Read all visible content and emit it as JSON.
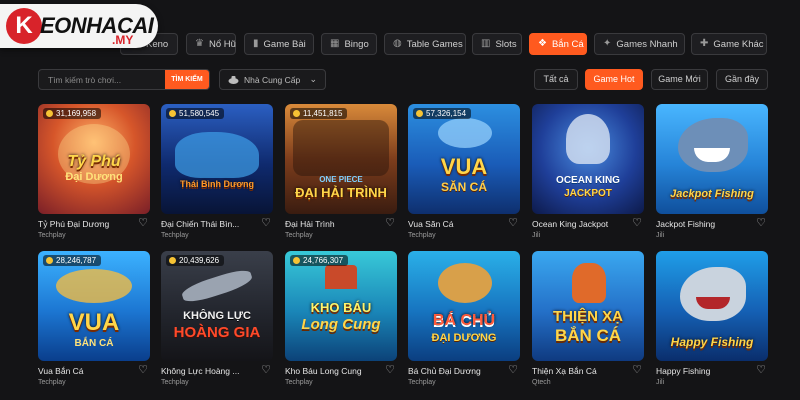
{
  "logo": {
    "letter": "K",
    "text": "EONHACAI",
    "suffix": ".MY"
  },
  "categories": [
    {
      "label": "Keno",
      "icon": "keno-icon",
      "glyph": "◉"
    },
    {
      "label": "Nổ Hũ",
      "icon": "jar-icon",
      "glyph": "♛"
    },
    {
      "label": "Game Bài",
      "icon": "cards-icon",
      "glyph": "▮"
    },
    {
      "label": "Bingo",
      "icon": "bingo-icon",
      "glyph": "▦"
    },
    {
      "label": "Table Games",
      "icon": "table-icon",
      "glyph": "◍"
    },
    {
      "label": "Slots",
      "icon": "slots-icon",
      "glyph": "▥"
    },
    {
      "label": "Bắn Cá",
      "icon": "fish-icon",
      "glyph": "❖",
      "active": true
    },
    {
      "label": "Games Nhanh",
      "icon": "quick-games-icon",
      "glyph": "✦"
    },
    {
      "label": "Game Khác",
      "icon": "other-games-icon",
      "glyph": "✚"
    }
  ],
  "search": {
    "placeholder": "Tìm kiếm trò chơi...",
    "button": "TÌM KIẾM"
  },
  "provider_select": {
    "label": "Nhà Cung Cấp",
    "icon": "provider-icon"
  },
  "filter_tabs": [
    {
      "label": "Tất cả"
    },
    {
      "label": "Game Hot",
      "active": true
    },
    {
      "label": "Game Mới"
    },
    {
      "label": "Gần đây"
    }
  ],
  "games": [
    {
      "name": "Tỷ Phú Đại Dương",
      "provider": "Techplay",
      "jackpot": "31,169,958",
      "art_line1": "Tỷ Phú",
      "art_line2": "Đại Dương"
    },
    {
      "name": "Đại Chiến Thái Bìn...",
      "provider": "Techplay",
      "jackpot": "51,580,545",
      "art_line1": "Thái Bình Dương",
      "art_line2": ""
    },
    {
      "name": "Đại Hải Trình",
      "provider": "Techplay",
      "jackpot": "11,451,815",
      "art_line1": "ĐẠI HẢI TRÌNH",
      "art_line2": "ONE PIECE"
    },
    {
      "name": "Vua Săn Cá",
      "provider": "Techplay",
      "jackpot": "57,326,154",
      "art_line1": "VUA",
      "art_line2": "SĂN CÁ"
    },
    {
      "name": "Ocean King Jackpot",
      "provider": "Jili",
      "jackpot": "",
      "art_line1": "OCEAN KING",
      "art_line2": "JACKPOT"
    },
    {
      "name": "Jackpot Fishing",
      "provider": "Jili",
      "jackpot": "",
      "art_line1": "Jackpot Fishing",
      "art_line2": ""
    },
    {
      "name": "Vua Bắn Cá",
      "provider": "Techplay",
      "jackpot": "28,246,787",
      "art_line1": "VUA",
      "art_line2": "BẮN CÁ"
    },
    {
      "name": "Không Lực Hoàng ...",
      "provider": "Techplay",
      "jackpot": "20,439,626",
      "art_line1": "KHÔNG LỰC",
      "art_line2": "HOÀNG GIA"
    },
    {
      "name": "Kho Báu Long Cung",
      "provider": "Techplay",
      "jackpot": "24,766,307",
      "art_line1": "KHO BÁU",
      "art_line2": "Long Cung"
    },
    {
      "name": "Bá Chủ Đại Dương",
      "provider": "Techplay",
      "jackpot": "",
      "art_line1": "BÁ CHỦ",
      "art_line2": "ĐẠI DƯƠNG"
    },
    {
      "name": "Thiện Xạ Bắn Cá",
      "provider": "Qtech",
      "jackpot": "",
      "art_line1": "THIỆN XẠ",
      "art_line2": "BẮN CÁ"
    },
    {
      "name": "Happy Fishing",
      "provider": "Jili",
      "jackpot": "",
      "art_line1": "Happy Fishing",
      "art_line2": ""
    }
  ],
  "colors": {
    "accent": "#ff5a1f",
    "background": "#141416",
    "logo_red": "#d8232a"
  }
}
